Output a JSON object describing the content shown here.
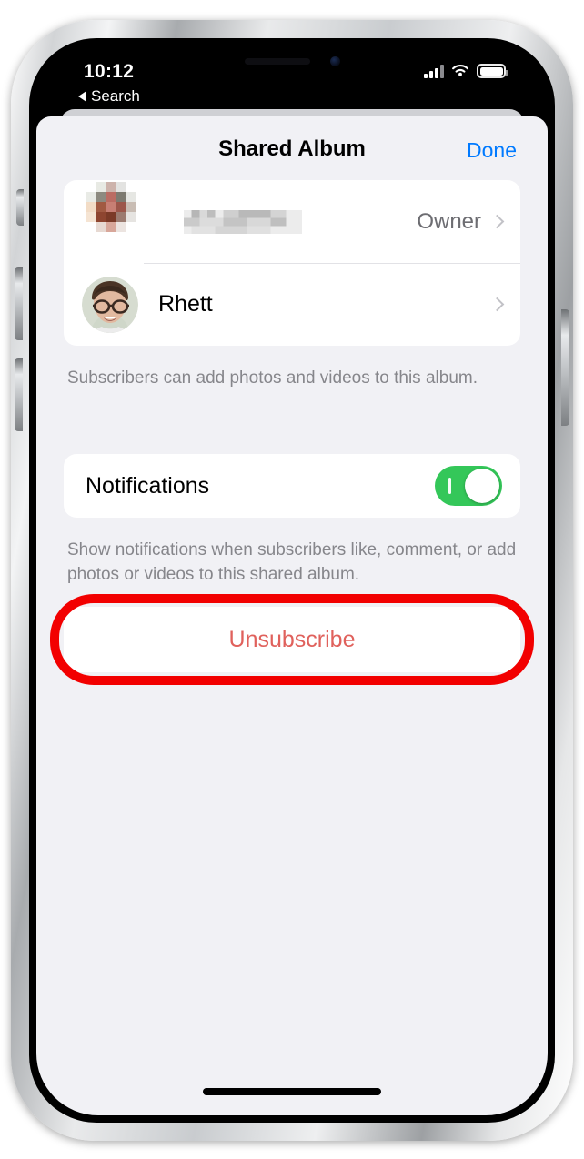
{
  "status_bar": {
    "time": "10:12",
    "cellular_icon": "signal-bars-icon",
    "wifi_icon": "wifi-icon",
    "battery_icon": "battery-full-icon",
    "battery_level_percent": 100
  },
  "back_to_app": {
    "label": "Search",
    "icon": "back-caret-icon"
  },
  "sheet": {
    "title": "Shared Album",
    "done_label": "Done"
  },
  "people": {
    "rows": [
      {
        "name": "",
        "name_redacted": true,
        "avatar_redacted": true,
        "role": "Owner",
        "chevron": "chevron-right-icon"
      },
      {
        "name": "Rhett",
        "name_redacted": false,
        "avatar_redacted": false,
        "role": "",
        "chevron": "chevron-right-icon"
      }
    ],
    "footnote": "Subscribers can add photos and videos to this album."
  },
  "notifications": {
    "label": "Notifications",
    "enabled": true,
    "toggle_state": "on",
    "footnote": "Show notifications when subscribers like, comment, or add photos or videos to this shared album."
  },
  "unsubscribe": {
    "label": "Unsubscribe",
    "annotated": true
  },
  "colors": {
    "accent_blue": "#007AFF",
    "toggle_green": "#34C759",
    "destructive_red": "#E0615C",
    "annotation_red": "#F20000",
    "sheet_background": "#F1F1F5",
    "card_background": "#FFFFFF",
    "footnote_gray": "#86868B"
  }
}
